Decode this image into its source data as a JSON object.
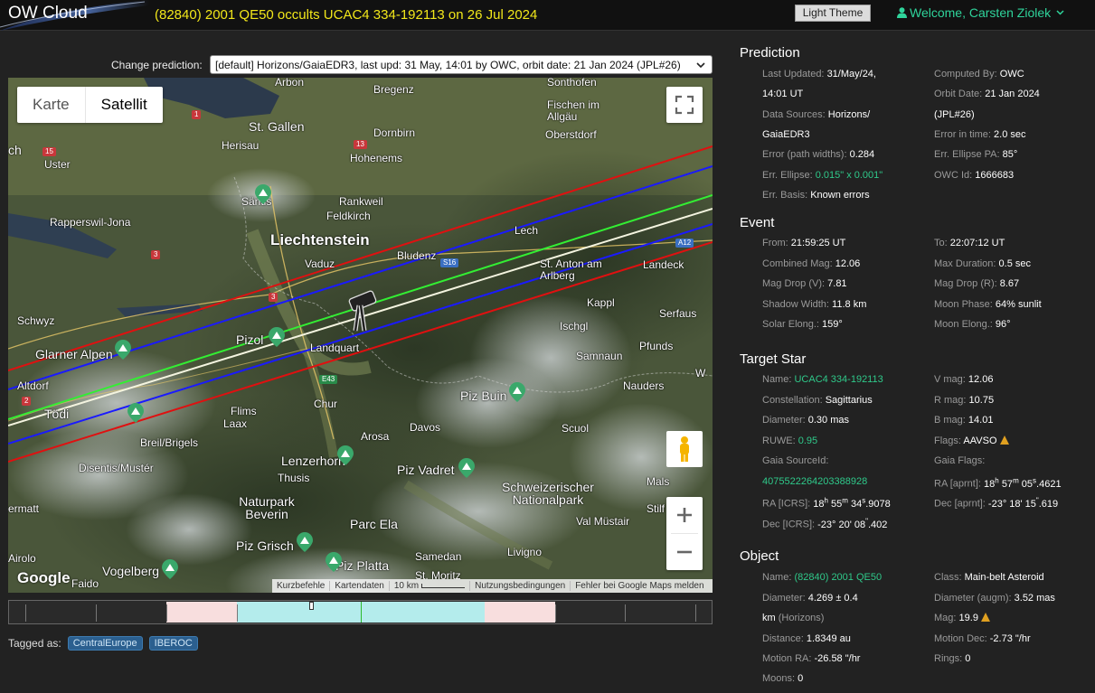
{
  "header": {
    "logo": "OW Cloud",
    "title": "(82840) 2001 QE50 occults UCAC4 334-192113 on 26 Jul 2024",
    "theme_button": "Light Theme",
    "welcome": "Welcome, Carsten Ziolek",
    "icons": [
      "user-icon",
      "chevron-down-icon"
    ]
  },
  "prediction_selector": {
    "label": "Change prediction:",
    "selected": "[default] Horizons/GaiaEDR3, last upd: 31 May, 14:01 by OWC, orbit date: 21 Jan 2024 (JPL#26)"
  },
  "map": {
    "type_buttons": [
      "Karte",
      "Satellit"
    ],
    "active_type": "Satellit",
    "footer": [
      "Kurzbefehle",
      "Kartendaten",
      "10 km",
      "Nutzungsbedingungen",
      "Fehler bei Google Maps melden"
    ],
    "google": "Google",
    "labels": {
      "arbon": "Arbon",
      "bregenz": "Bregenz",
      "sonthofen": "Sonthofen",
      "stgallen": "St. Gallen",
      "herisau": "Herisau",
      "dornbirn": "Dornbirn",
      "fischen": "Fischen im Allgäu",
      "oberstdorf": "Oberstdorf",
      "ch": "ch",
      "uster": "Uster",
      "hohenems": "Hohenems",
      "saentis": "Säntis",
      "rankweil": "Rankweil",
      "feldkirch": "Feldkirch",
      "rapperswil": "Rapperswil-Jona",
      "liechtenstein": "Liechtenstein",
      "lech": "Lech",
      "vaduz": "Vaduz",
      "bludenz": "Bludenz",
      "stanton": "St. Anton am Arlberg",
      "landeck": "Landeck",
      "kappl": "Kappl",
      "schwyz": "Schwyz",
      "serfaus": "Serfaus",
      "ischgl": "Ischgl",
      "pizol": "Pizol",
      "landquart": "Landquart",
      "pfunds": "Pfunds",
      "glarner": "Glarner Alpen",
      "samnaun": "Samnaun",
      "altdorf": "Altdorf",
      "chur": "Chur",
      "pizbuin": "Piz Buin",
      "nauders": "Nauders",
      "toedi": "Tödi",
      "flims": "Flims",
      "laax": "Laax",
      "arosa": "Arosa",
      "davos": "Davos",
      "scuol": "Scuol",
      "breil": "Breil/Brigels",
      "lenzerhorn": "Lenzerhorn",
      "disentis": "Disentis/Mustér",
      "thusis": "Thusis",
      "pizvadret": "Piz Vadret",
      "schweizer": "Schweizerischer Nationalpark",
      "mals": "Mals",
      "naturpark": "Naturpark Beverin",
      "valmustair": "Val Müstair",
      "stilf": "Stilf",
      "ermatt": "ermatt",
      "parcela": "Parc Ela",
      "pizgrisch": "Piz Grisch",
      "livigno": "Livigno",
      "airolo": "Airolo",
      "samedan": "Samedan",
      "vogelberg": "Vogelberg",
      "pizplatta": "Piz Platta",
      "faido": "Faido",
      "stmoritz": "St. Moritz",
      "ws": "W"
    },
    "road_badges": [
      "1",
      "13",
      "15",
      "3",
      "3",
      "S16",
      "A12",
      "E43",
      "2"
    ],
    "line_colors": {
      "outer": "#e01010",
      "mid": "#1a1aff",
      "center_green": "#33ee33",
      "center": "#f4f4e0"
    }
  },
  "timeline": {
    "segments": [
      "pink",
      "cyan",
      "pink"
    ]
  },
  "tags": {
    "label": "Tagged as:",
    "items": [
      "CentralEurope",
      "IBEROC"
    ]
  },
  "prediction": {
    "title": "Prediction",
    "last_updated_label": "Last Updated:",
    "last_updated": "31/May/24,",
    "last_updated2": "14:01 UT",
    "computed_by_label": "Computed By:",
    "computed_by": "OWC",
    "data_sources_label": "Data Sources:",
    "data_sources": "Horizons/",
    "data_sources2": "GaiaEDR3",
    "orbit_date_label": "Orbit Date:",
    "orbit_date": "21 Jan 2024",
    "orbit_date2": "(JPL#26)",
    "error_time_label": "Error in time:",
    "error_time": "2.0 sec",
    "error_path_label": "Error (path widths):",
    "error_path": "0.284",
    "err_pa_label": "Err. Ellipse PA:",
    "err_pa": "85°",
    "err_ellipse_label": "Err. Ellipse:",
    "err_ellipse": "0.015\" x 0.001\"",
    "owc_id_label": "OWC Id:",
    "owc_id": "1666683",
    "err_basis_label": "Err. Basis:",
    "err_basis": "Known errors"
  },
  "event": {
    "title": "Event",
    "from_label": "From:",
    "from": "21:59:25 UT",
    "to_label": "To:",
    "to": "22:07:12 UT",
    "combined_mag_label": "Combined Mag:",
    "combined_mag": "12.06",
    "max_duration_label": "Max Duration:",
    "max_duration": "0.5 sec",
    "mag_drop_v_label": "Mag Drop (V):",
    "mag_drop_v": "7.81",
    "mag_drop_r_label": "Mag Drop (R):",
    "mag_drop_r": "8.67",
    "shadow_width_label": "Shadow Width:",
    "shadow_width": "11.8 km",
    "moon_phase_label": "Moon Phase:",
    "moon_phase": "64% sunlit",
    "solar_elong_label": "Solar Elong.:",
    "solar_elong": "159°",
    "moon_elong_label": "Moon Elong.:",
    "moon_elong": "96°"
  },
  "target_star": {
    "title": "Target Star",
    "name_label": "Name:",
    "name": "UCAC4 334-192113",
    "vmag_label": "V mag:",
    "vmag": "12.06",
    "constellation_label": "Constellation:",
    "constellation": "Sagittarius",
    "rmag_label": "R mag:",
    "rmag": "10.75",
    "diameter_label": "Diameter:",
    "diameter": "0.30 mas",
    "bmag_label": "B mag:",
    "bmag": "14.01",
    "ruwe_label": "RUWE:",
    "ruwe": "0.95",
    "flags_label": "Flags:",
    "flags": "AAVSO",
    "gaia_sourceid_label": "Gaia SourceId:",
    "gaia_sourceid": "4075522264203388928",
    "gaia_flags_label": "Gaia Flags:",
    "ra_aprnt_label": "RA [aprnt]:",
    "ra_aprnt_h": "18",
    "ra_aprnt_m": "57",
    "ra_aprnt_s": "05",
    "ra_aprnt_frac": ".4621",
    "ra_icrs_label": "RA [ICRS]:",
    "ra_icrs_h": "18",
    "ra_icrs_m": "55",
    "ra_icrs_s": "34",
    "ra_icrs_frac": ".9078",
    "dec_aprnt_label": "Dec [aprnt]:",
    "dec_aprnt": "-23° 18' 15",
    "dec_aprnt_frac": ".619",
    "dec_icrs_label": "Dec [ICRS]:",
    "dec_icrs": "-23° 20' 08",
    "dec_icrs_frac": ".402"
  },
  "object": {
    "title": "Object",
    "name_label": "Name:",
    "name": "(82840) 2001 QE50",
    "class_label": "Class:",
    "class": "Main-belt Asteroid",
    "diameter_label": "Diameter:",
    "diameter": "4.269 ± 0.4",
    "diameter2": "km",
    "diameter_src": "(Horizons)",
    "diameter_augm_label": "Diameter (augm):",
    "diameter_augm": "3.52 mas",
    "mag_label": "Mag:",
    "mag": "19.9",
    "distance_label": "Distance:",
    "distance": "1.8349 au",
    "motion_dec_label": "Motion Dec:",
    "motion_dec": "-2.73 \"/hr",
    "motion_ra_label": "Motion RA:",
    "motion_ra": "-26.58 \"/hr",
    "rings_label": "Rings:",
    "rings": "0",
    "moons_label": "Moons:",
    "moons": "0"
  }
}
